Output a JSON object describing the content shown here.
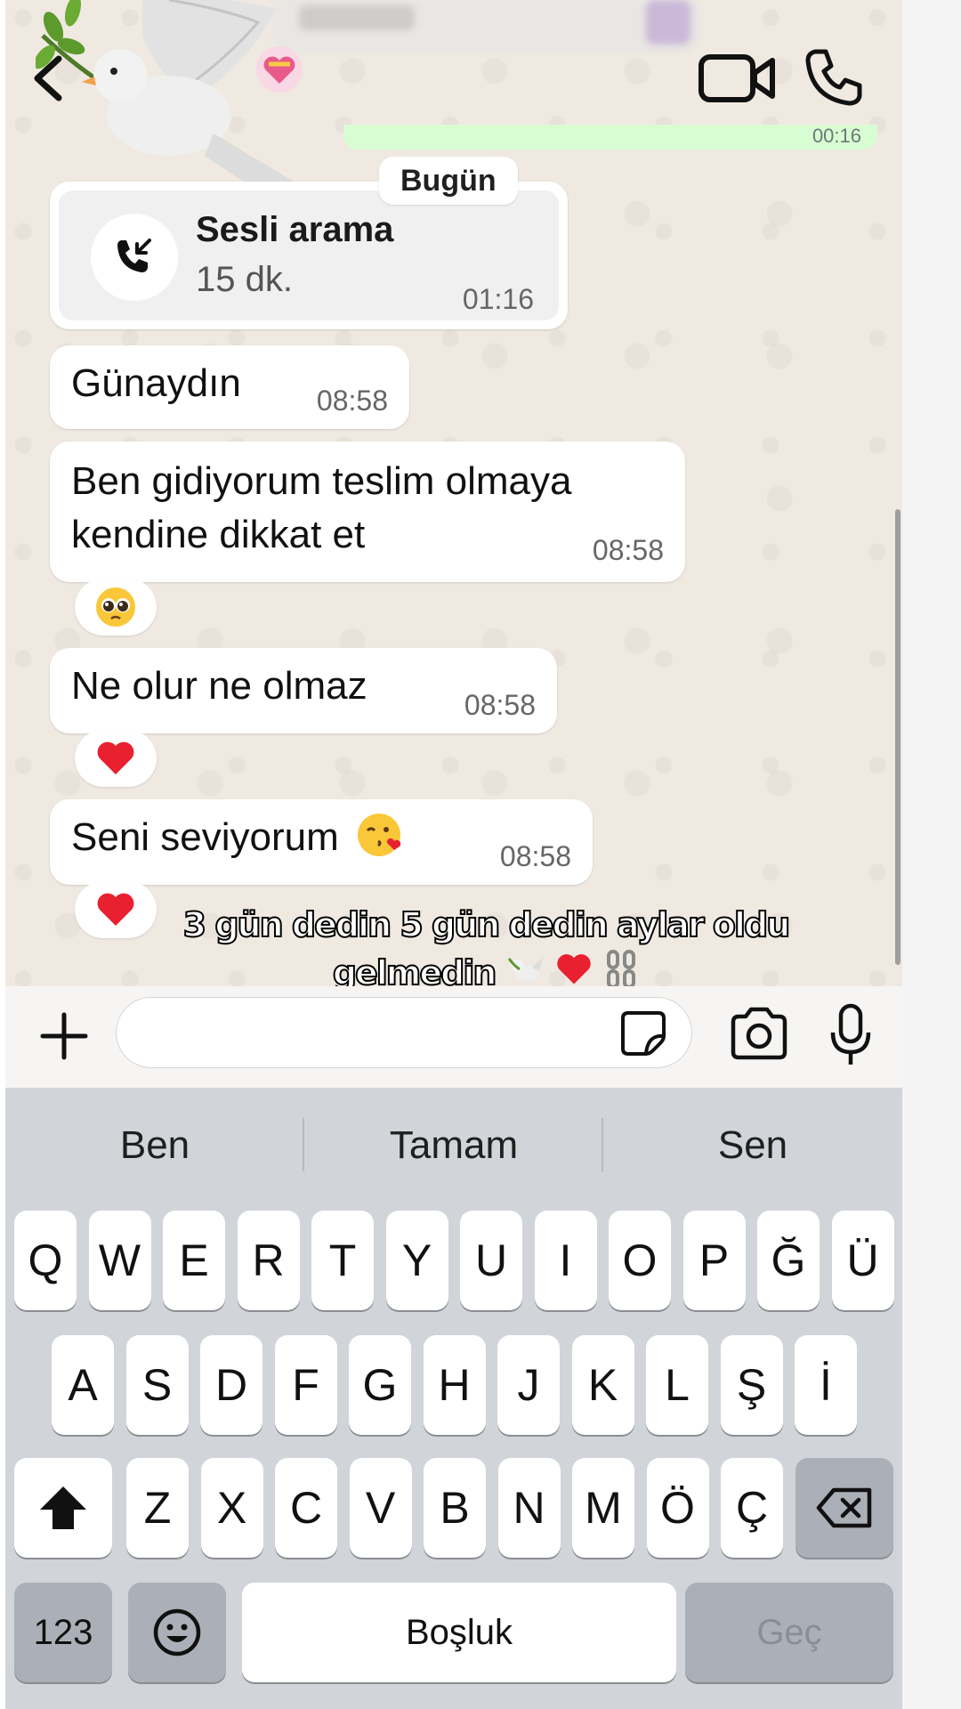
{
  "header": {
    "back_icon": "chevron-left-icon",
    "video_icon": "video-camera-icon",
    "call_icon": "phone-icon",
    "previous_message_time": "00:16"
  },
  "date_chip": "Bugün",
  "call": {
    "title": "Sesli arama",
    "duration": "15 dk.",
    "time": "01:16",
    "icon": "incoming-call-icon"
  },
  "messages": [
    {
      "text": "Günaydın",
      "time": "08:58",
      "reaction": null
    },
    {
      "text_lines": [
        "Ben gidiyorum teslim olmaya",
        "kendine dikkat et"
      ],
      "time": "08:58",
      "reaction": "pleading-face-emoji"
    },
    {
      "text": "Ne olur ne olmaz",
      "time": "08:58",
      "reaction": "red-heart-emoji"
    },
    {
      "text": "Seni seviyorum",
      "emoji": "face-blowing-kiss-emoji",
      "time": "08:58",
      "reaction": "red-heart-emoji"
    }
  ],
  "caption": {
    "line1": "3 gün dedin 5 gün dedin aylar oldu",
    "line2": "gelmedin",
    "emojis": [
      "dove-emoji",
      "red-heart-emoji",
      "broken-chain-emoji"
    ]
  },
  "input_bar": {
    "placeholder": "",
    "icons": [
      "plus-icon",
      "sticker-icon",
      "camera-icon",
      "microphone-icon"
    ]
  },
  "keyboard": {
    "suggestions": [
      "Ben",
      "Tamam",
      "Sen"
    ],
    "row1": [
      "Q",
      "W",
      "E",
      "R",
      "T",
      "Y",
      "U",
      "I",
      "O",
      "P",
      "Ğ",
      "Ü"
    ],
    "row2": [
      "A",
      "S",
      "D",
      "F",
      "G",
      "H",
      "J",
      "K",
      "L",
      "Ş",
      "İ"
    ],
    "row3": [
      "Z",
      "X",
      "C",
      "V",
      "B",
      "N",
      "M",
      "Ö",
      "Ç"
    ],
    "numbers_label": "123",
    "space_label": "Boşluk",
    "return_label": "Geç"
  },
  "colors": {
    "chat_background": "#efe9e1",
    "outgoing_bubble": "#d9fdd3",
    "incoming_bubble": "#ffffff",
    "keyboard_background": "#d1d4d9",
    "heart_red": "#e8202f"
  }
}
